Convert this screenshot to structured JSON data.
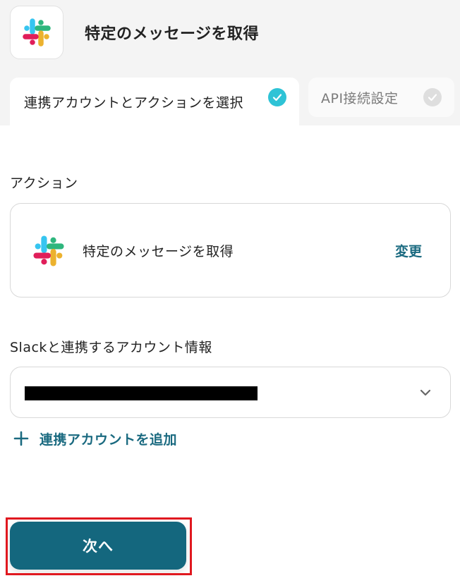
{
  "header": {
    "title": "特定のメッセージを取得",
    "app_icon": "slack-logo-icon"
  },
  "tabs": [
    {
      "label": "連携アカウントとアクションを選択",
      "state": "active",
      "status_icon": "check-icon"
    },
    {
      "label": "API接続設定",
      "state": "inactive",
      "status_icon": "check-icon"
    }
  ],
  "action_section": {
    "label": "アクション",
    "card": {
      "icon": "slack-logo-icon",
      "text": "特定のメッセージを取得",
      "change_label": "変更"
    }
  },
  "account_section": {
    "label": "Slackと連携するアカウント情報",
    "selected_value": "",
    "selected_value_redacted": true,
    "dropdown_icon": "chevron-down-icon",
    "add_account_label": "連携アカウントを追加",
    "add_icon": "plus-icon"
  },
  "footer": {
    "next_label": "次へ"
  },
  "colors": {
    "accent": "#14677e",
    "link": "#1a6a80",
    "check_active": "#2ec3d6",
    "check_inactive": "#dedede",
    "highlight": "#e0181f",
    "band_background": "#f4f4f4"
  }
}
